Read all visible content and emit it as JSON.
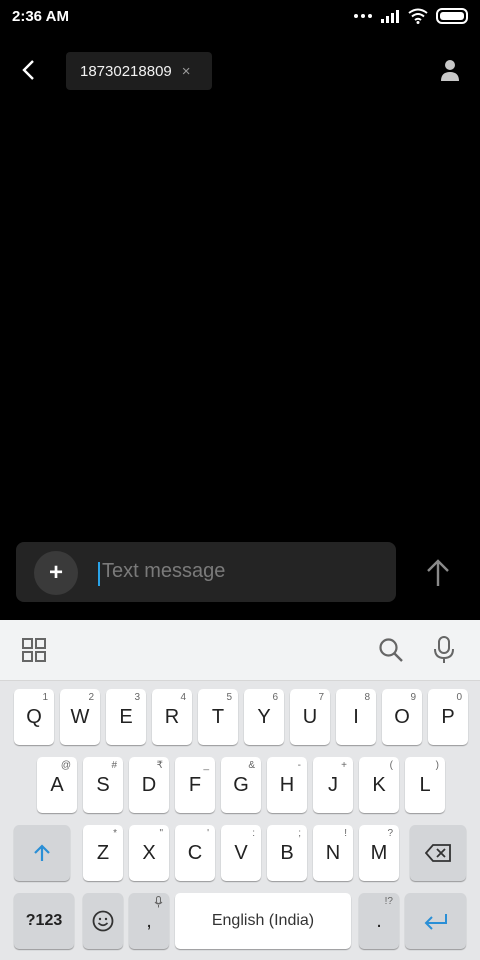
{
  "status_bar": {
    "time": "2:36 AM"
  },
  "header": {
    "recipient": "18730218809",
    "chip_close": "×"
  },
  "composer": {
    "placeholder": "Text message",
    "plus_label": "+"
  },
  "keyboard": {
    "row1": [
      {
        "label": "Q",
        "hint": "1"
      },
      {
        "label": "W",
        "hint": "2"
      },
      {
        "label": "E",
        "hint": "3"
      },
      {
        "label": "R",
        "hint": "4"
      },
      {
        "label": "T",
        "hint": "5"
      },
      {
        "label": "Y",
        "hint": "6"
      },
      {
        "label": "U",
        "hint": "7"
      },
      {
        "label": "I",
        "hint": "8"
      },
      {
        "label": "O",
        "hint": "9"
      },
      {
        "label": "P",
        "hint": "0"
      }
    ],
    "row2": [
      {
        "label": "A",
        "hint": "@"
      },
      {
        "label": "S",
        "hint": "#"
      },
      {
        "label": "D",
        "hint": "₹"
      },
      {
        "label": "F",
        "hint": "_"
      },
      {
        "label": "G",
        "hint": "&"
      },
      {
        "label": "H",
        "hint": "-"
      },
      {
        "label": "J",
        "hint": "+"
      },
      {
        "label": "K",
        "hint": "("
      },
      {
        "label": "L",
        "hint": ")"
      }
    ],
    "row3": [
      {
        "label": "Z",
        "hint": "*"
      },
      {
        "label": "X",
        "hint": "\""
      },
      {
        "label": "C",
        "hint": "'"
      },
      {
        "label": "V",
        "hint": ":"
      },
      {
        "label": "B",
        "hint": ";"
      },
      {
        "label": "N",
        "hint": "!"
      },
      {
        "label": "M",
        "hint": "?"
      }
    ],
    "symbols_label": "?123",
    "comma_label": ",",
    "space_label": "English (India)",
    "period_label": ".",
    "period_hint": "!?"
  }
}
